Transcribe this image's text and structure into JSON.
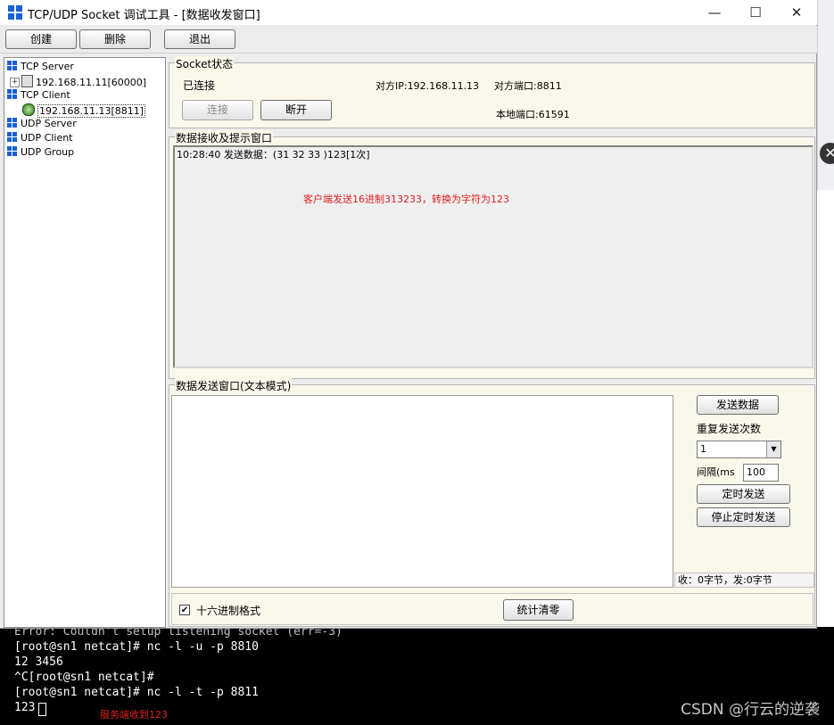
{
  "window": {
    "title": "TCP/UDP Socket 调试工具 - [数据收发窗口]",
    "minimize": "—",
    "maximize": "☐",
    "close": "✕"
  },
  "toolbar": {
    "create": "创建",
    "delete": "删除",
    "exit": "退出"
  },
  "tree": {
    "tcp_server": "TCP Server",
    "tcp_server_child": "192.168.11.11[60000]",
    "tcp_client": "TCP Client",
    "tcp_client_child": "192.168.11.13[8811]",
    "udp_server": "UDP Server",
    "udp_client": "UDP Client",
    "udp_group": "UDP Group"
  },
  "socket_status": {
    "label": "Socket状态",
    "state": "已连接",
    "peer_ip": "对方IP:192.168.11.13",
    "peer_port": "对方端口:8811",
    "local_port": "本地端口:61591",
    "connect_button": "连接",
    "disconnect_button": "断开"
  },
  "receive": {
    "label": "数据接收及提示窗口",
    "log": "10:28:40 发送数据：(31 32 33 )123[1次]",
    "annotation": "客户端发送16进制313233，转换为字符为123"
  },
  "send": {
    "label": "数据发送窗口(文本模式)",
    "text": "",
    "send_button": "发送数据",
    "repeat_label": "重复发送次数",
    "repeat_value": "1",
    "interval_label": "间隔(ms",
    "interval_value": "100",
    "timed_send_button": "定时发送",
    "stop_timed_button": "停止定时发送",
    "stats": "收：0字节，发:0字节",
    "hex_label": "十六进制格式",
    "hex_checked": true,
    "reset_stats_button": "统计清零"
  },
  "terminal": {
    "lines": [
      "Error: Couldn't setup listening socket (err=-3)",
      "[root@sn1 netcat]# nc -l -u -p 8810",
      "12 3456",
      "^C[root@sn1 netcat]#",
      "[root@sn1 netcat]# nc -l -t -p 8811",
      "123"
    ],
    "annotation": "服务端收到123",
    "watermark": "CSDN @行云的逆袭"
  },
  "background_window": {
    "close": "✕"
  },
  "colors": {
    "accent_blue": "#1a5fd6",
    "annotation_red": "#e02020",
    "panel_bg": "#faf7eb",
    "terminal_bg": "#000000"
  }
}
